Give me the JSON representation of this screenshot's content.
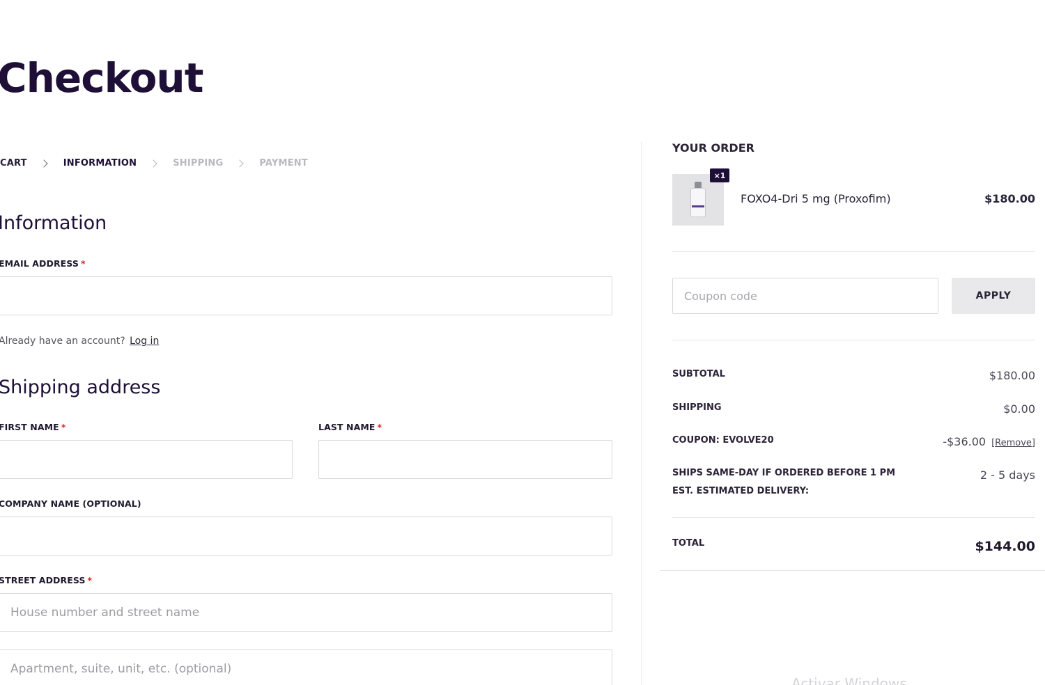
{
  "page": {
    "title": "Checkout"
  },
  "breadcrumb": [
    {
      "label": "CART",
      "state": "done"
    },
    {
      "label": "INFORMATION",
      "state": "active"
    },
    {
      "label": "SHIPPING",
      "state": "todo"
    },
    {
      "label": "PAYMENT",
      "state": "todo"
    }
  ],
  "information": {
    "heading": "Information",
    "email_label": "EMAIL ADDRESS",
    "email_value": "",
    "account_prompt": "Already have an account?",
    "login_link": "Log in"
  },
  "shipping_address": {
    "heading": "Shipping address",
    "first_name_label": "FIRST NAME",
    "last_name_label": "LAST NAME",
    "company_label": "COMPANY NAME (OPTIONAL)",
    "street_label": "STREET ADDRESS",
    "street_placeholder": "House number and street name",
    "apartment_placeholder": "Apartment, suite, unit, etc. (optional)",
    "required_marker": "*"
  },
  "order": {
    "heading": "YOUR ORDER",
    "item": {
      "quantity_badge": "×1",
      "name": "FOXO4-Dri 5 mg (Proxofim)",
      "price": "$180.00"
    },
    "coupon_placeholder": "Coupon code",
    "apply_label": "APPLY",
    "subtotal_label": "SUBTOTAL",
    "subtotal_value": "$180.00",
    "shipping_label": "SHIPPING",
    "shipping_value": "$0.00",
    "coupon_label": "COUPON: EVOLVE20",
    "coupon_value": "-$36.00",
    "coupon_remove": "[Remove]",
    "ship_note_line1": "SHIPS SAME-DAY IF ORDERED BEFORE 1 PM",
    "ship_note_line2": "EST. ESTIMATED DELIVERY:",
    "delivery_value": "2 - 5 days",
    "total_label": "TOTAL",
    "total_value": "$144.00"
  },
  "watermark": "Activar Windows",
  "colors": {
    "brand": "#1e0f36",
    "required": "#e02424",
    "muted": "#b9b9bf"
  }
}
